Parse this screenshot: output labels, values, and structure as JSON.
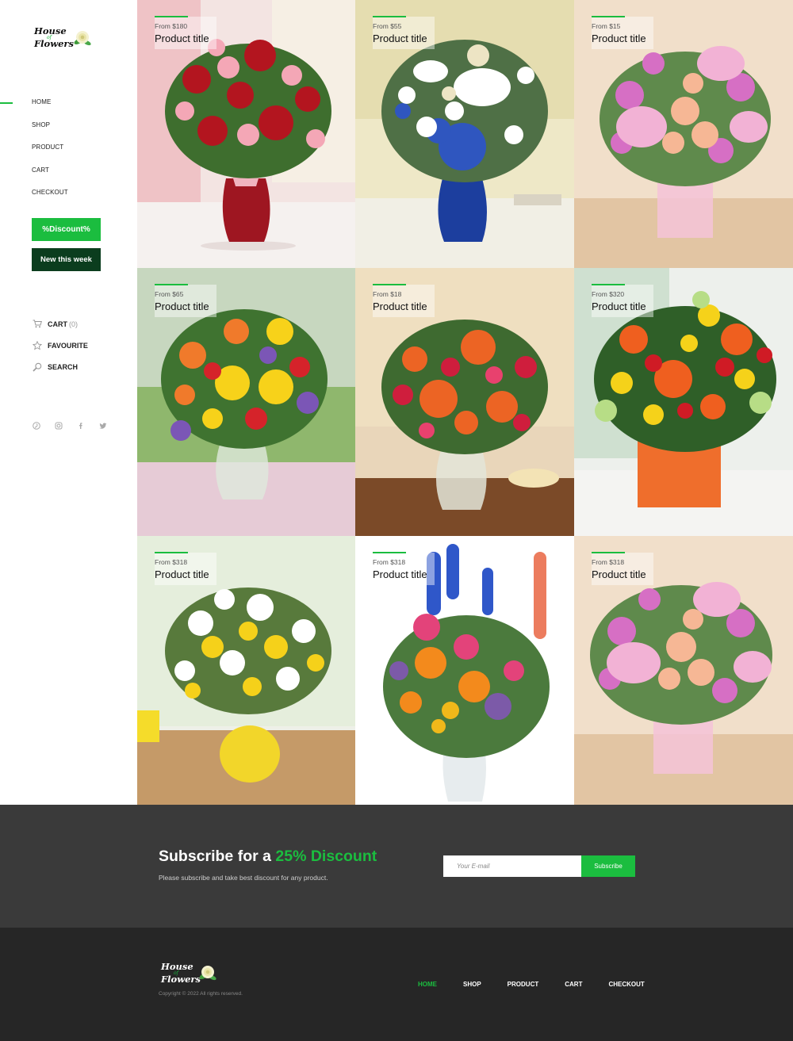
{
  "brand": {
    "line1": "House",
    "line2": "of",
    "line3": "Flowers"
  },
  "nav": {
    "items": [
      "HOME",
      "SHOP",
      "PRODUCT",
      "CART",
      "CHECKOUT"
    ],
    "active": "HOME"
  },
  "promo": {
    "discount_label": "%Discount%",
    "new_label": "New this week"
  },
  "utility": {
    "cart_label": "CART",
    "cart_count": "(0)",
    "favourite_label": "FAVOURITE",
    "search_label": "SEARCH"
  },
  "social": [
    "pinterest-icon",
    "instagram-icon",
    "facebook-icon",
    "twitter-icon"
  ],
  "products": [
    {
      "price": "From $180",
      "title": "Product title"
    },
    {
      "price": "From $55",
      "title": "Product title"
    },
    {
      "price": "From $15",
      "title": "Product title"
    },
    {
      "price": "From $65",
      "title": "Product title"
    },
    {
      "price": "From $18",
      "title": "Product title"
    },
    {
      "price": "From $320",
      "title": "Product title"
    },
    {
      "price": "From $318",
      "title": "Product title"
    },
    {
      "price": "From $318",
      "title": "Product title"
    },
    {
      "price": "From $318",
      "title": "Product title"
    }
  ],
  "subscribe": {
    "heading_pre": "Subscribe for a ",
    "heading_accent": "25% Discount",
    "text": "Please subscribe and take best discount for any product.",
    "placeholder": "Your E-mail",
    "button": "Subscribe"
  },
  "footer": {
    "copyright": "Copyright © 2022 All rights reserved.",
    "nav": [
      "HOME",
      "SHOP",
      "PRODUCT",
      "CART",
      "CHECKOUT"
    ]
  },
  "colors": {
    "accent": "#1bbd3f",
    "dark_green": "#0b3d1e",
    "subscribe_bg": "#3a3a3a",
    "footer_bg": "#262626"
  }
}
